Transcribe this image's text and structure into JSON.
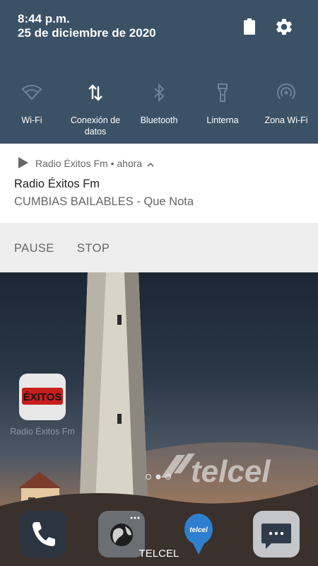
{
  "status": {
    "time": "8:44 p.m.",
    "date": "25 de diciembre de 2020"
  },
  "quick_settings": [
    {
      "label": "Wi-Fi",
      "icon": "wifi-icon"
    },
    {
      "label": "Conexión de datos",
      "icon": "mobile-data-icon"
    },
    {
      "label": "Bluetooth",
      "icon": "bluetooth-icon"
    },
    {
      "label": "Linterna",
      "icon": "flashlight-icon"
    },
    {
      "label": "Zona Wi-Fi",
      "icon": "hotspot-icon"
    }
  ],
  "notification": {
    "app_name": "Radio Éxitos Fm",
    "time": "ahora",
    "title": "Radio Éxitos Fm",
    "text": "CUMBIAS BAILABLES - Que Nota",
    "actions": [
      "PAUSE",
      "STOP"
    ]
  },
  "home": {
    "app_label": "Radio Éxitos Fm",
    "logo_text": "ÉXITOS",
    "watermark": "telcel",
    "carrier": "TELCEL",
    "dock": [
      "phone-icon",
      "browser-icon",
      "telcel-balloon-icon",
      "messages-icon"
    ]
  }
}
